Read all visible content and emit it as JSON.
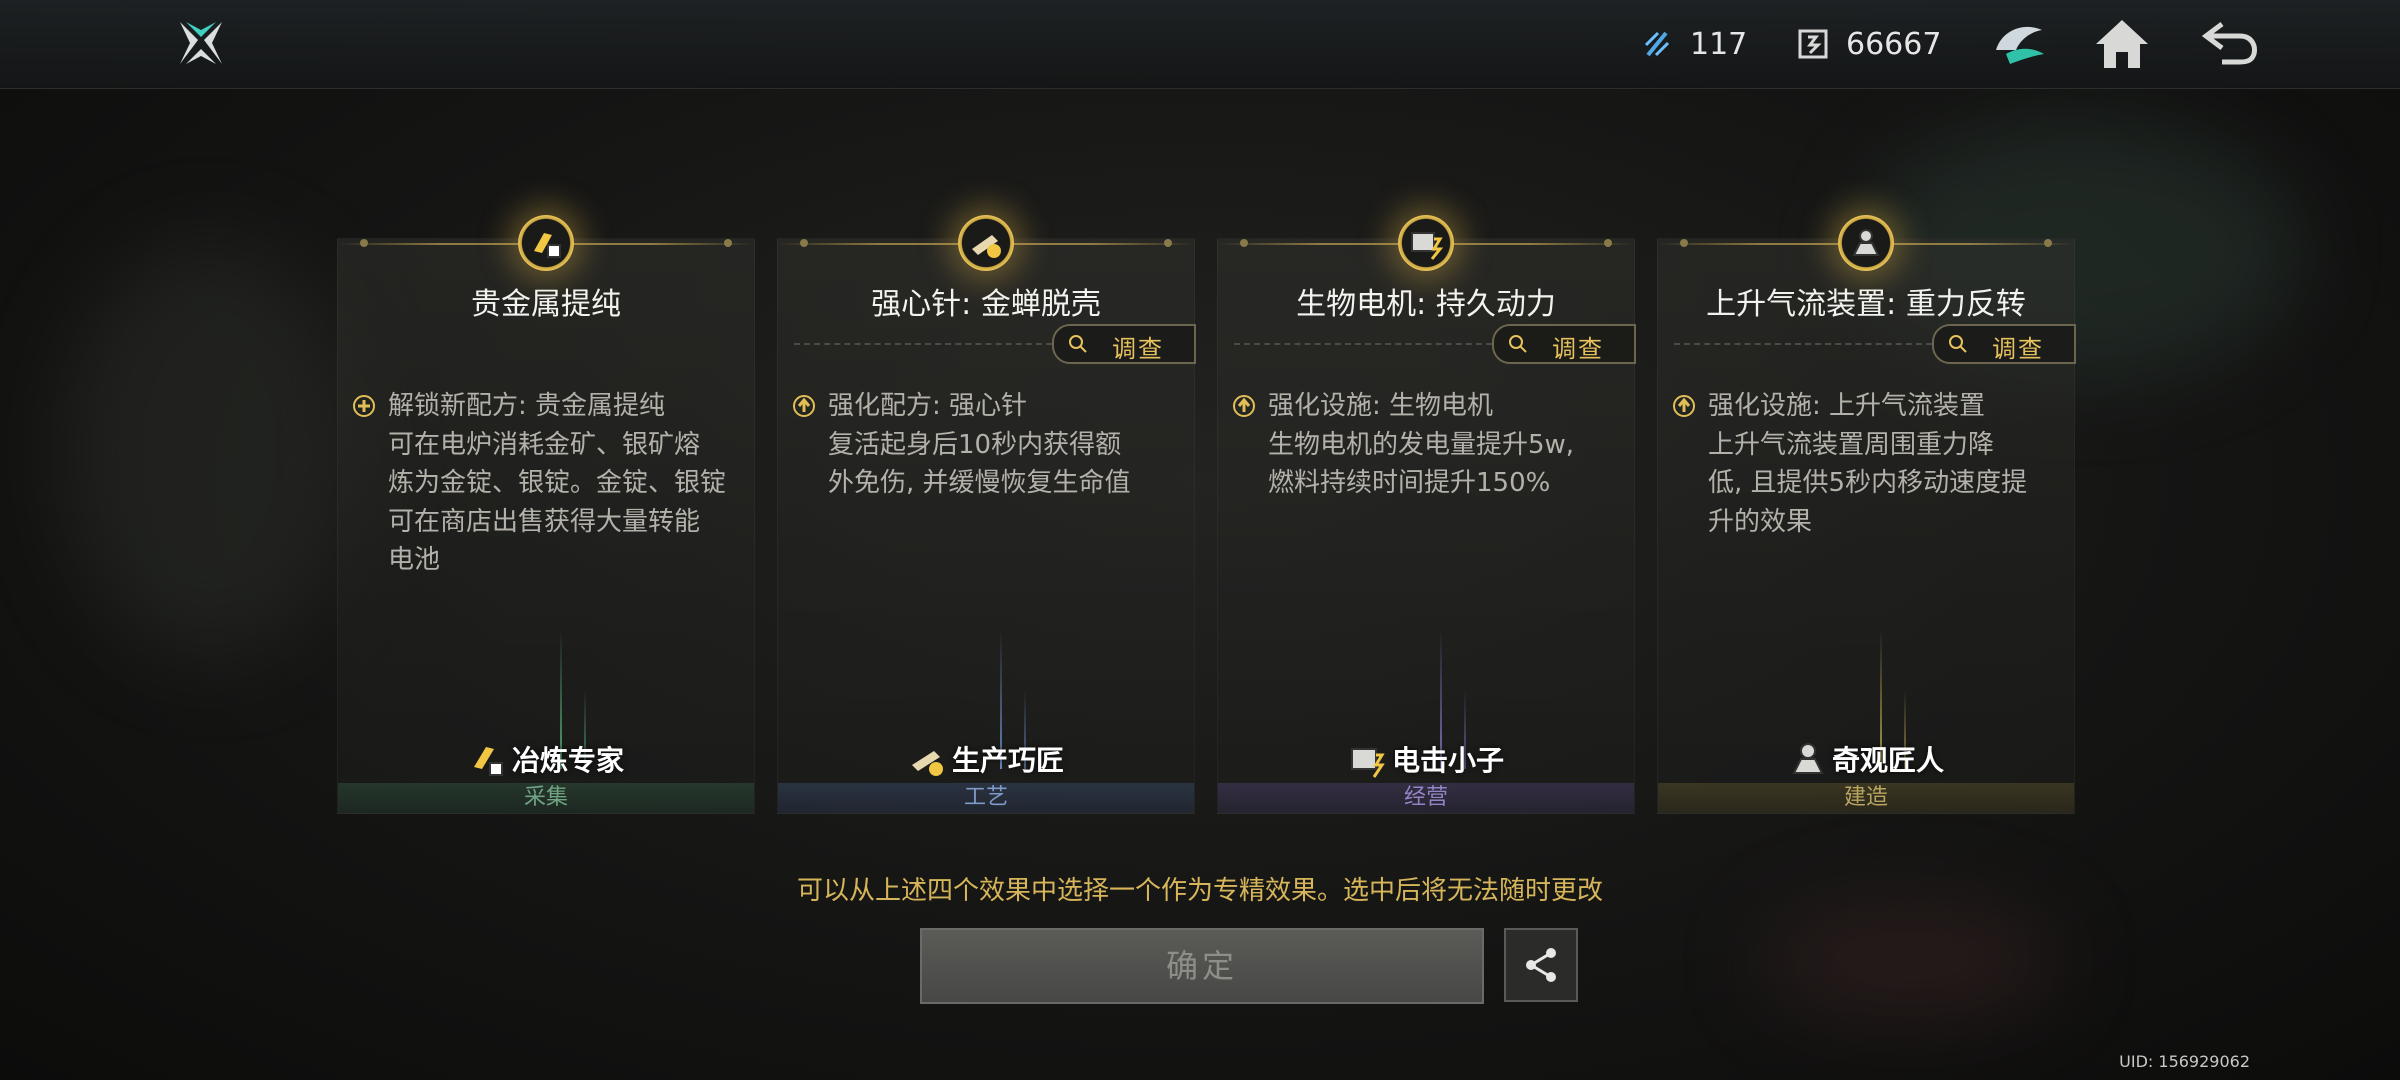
{
  "header": {
    "resources": [
      {
        "icon": "energy-crystal-icon",
        "value": "117"
      },
      {
        "icon": "chip-coin-icon",
        "value": "66667"
      }
    ],
    "icons": [
      "faction-emblem-icon",
      "home-icon",
      "back-icon"
    ]
  },
  "cards": [
    {
      "title": "贵金属提纯",
      "medal_icon": "gold-ingot-icon",
      "show_investigate": false,
      "badge_icon": "plus-circle-icon",
      "desc_head": "解锁新配方: 贵金属提纯",
      "desc_lines": [
        "可在电炉消耗金矿、银矿熔",
        "炼为金锭、银锭。金锭、银锭",
        "可在商店出售获得大量转能",
        "电池"
      ],
      "role": "冶炼专家",
      "category": "采集",
      "color": "#5fa07a"
    },
    {
      "title": "强心针: 金蝉脱壳",
      "medal_icon": "syringe-icon",
      "show_investigate": true,
      "badge_icon": "arrow-up-circle-icon",
      "desc_head": "强化配方: 强心针",
      "desc_lines": [
        "复活起身后10秒内获得额",
        "外免伤, 并缓慢恢复生命值"
      ],
      "role": "生产巧匠",
      "category": "工艺",
      "color": "#6f8fc0"
    },
    {
      "title": "生物电机: 持久动力",
      "medal_icon": "generator-icon",
      "show_investigate": true,
      "badge_icon": "arrow-up-circle-icon",
      "desc_head": "强化设施: 生物电机",
      "desc_lines": [
        "生物电机的发电量提升5w,",
        "燃料持续时间提升150%"
      ],
      "role": "电击小子",
      "category": "经营",
      "color": "#8a76c0"
    },
    {
      "title": "上升气流装置: 重力反转",
      "medal_icon": "updraft-device-icon",
      "show_investigate": true,
      "badge_icon": "arrow-up-circle-icon",
      "desc_head": "强化设施: 上升气流装置",
      "desc_lines": [
        "上升气流装置周围重力降",
        "低, 且提供5秒内移动速度提",
        "升的效果"
      ],
      "role": "奇观匠人",
      "category": "建造",
      "color": "#b3a050"
    }
  ],
  "investigate_label": "调查",
  "notice": "可以从上述四个效果中选择一个作为专精效果。选中后将无法随时更改",
  "confirm_label": "确定",
  "uid": "UID: 156929062"
}
